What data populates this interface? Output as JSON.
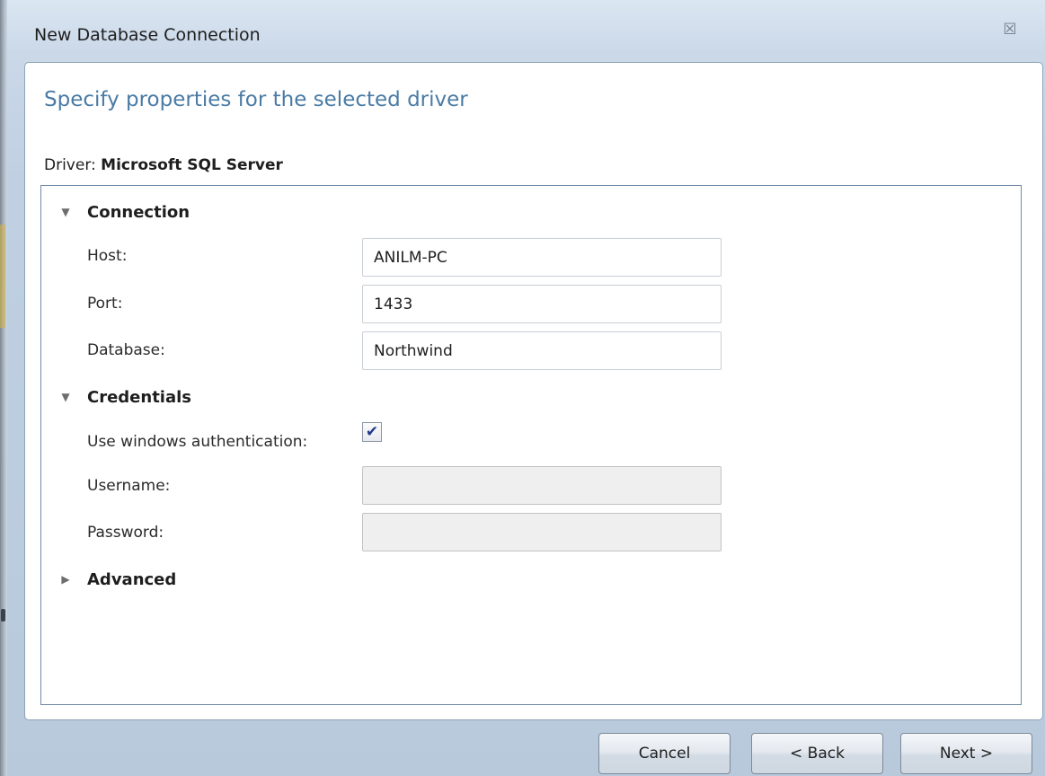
{
  "window": {
    "title": "New Database Connection",
    "close_glyph": "☒"
  },
  "dialog": {
    "heading": "Specify properties for the selected driver",
    "driver_label": "Driver:",
    "driver_name": "Microsoft SQL Server"
  },
  "sections": {
    "connection": {
      "label": "Connection",
      "expanded": true,
      "host_label": "Host:",
      "host_value": "ANILM-PC",
      "port_label": "Port:",
      "port_value": "1433",
      "database_label": "Database:",
      "database_value": "Northwind"
    },
    "credentials": {
      "label": "Credentials",
      "expanded": true,
      "windows_auth_label": "Use windows authentication:",
      "windows_auth_checked": true,
      "checkmark": "✔",
      "username_label": "Username:",
      "username_value": "",
      "password_label": "Password:",
      "password_value": ""
    },
    "advanced": {
      "label": "Advanced",
      "expanded": false
    }
  },
  "icons": {
    "expanded_arrow": "▼",
    "collapsed_arrow": "▶"
  },
  "buttons": {
    "cancel": "Cancel",
    "back": "< Back",
    "next": "Next >"
  },
  "colors": {
    "heading": "#4a7ba5",
    "checkmark": "#233a8c"
  }
}
